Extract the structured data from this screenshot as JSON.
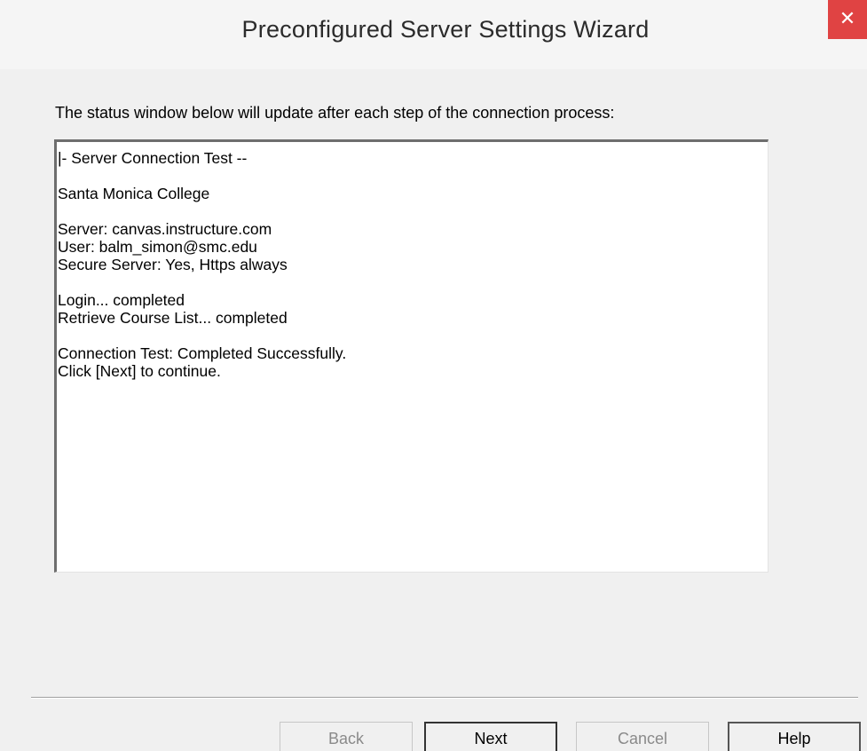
{
  "window": {
    "title": "Preconfigured Server Settings Wizard",
    "close_glyph": "✕"
  },
  "instruction": "The status window below will update after each step of the connection process:",
  "status_lines": [
    "|- Server Connection Test --",
    "",
    "Santa Monica College",
    "",
    "Server: canvas.instructure.com",
    "User: balm_simon@smc.edu",
    "Secure Server: Yes, Https always",
    "",
    "Login... completed",
    "Retrieve Course List... completed",
    "",
    "Connection Test: Completed Successfully.",
    "Click [Next] to continue."
  ],
  "buttons": {
    "back": "Back",
    "next": "Next",
    "cancel": "Cancel",
    "help": "Help"
  },
  "colors": {
    "close_button": "#e04343",
    "window_bg": "#f0f0f0",
    "status_bg": "#ffffff"
  }
}
